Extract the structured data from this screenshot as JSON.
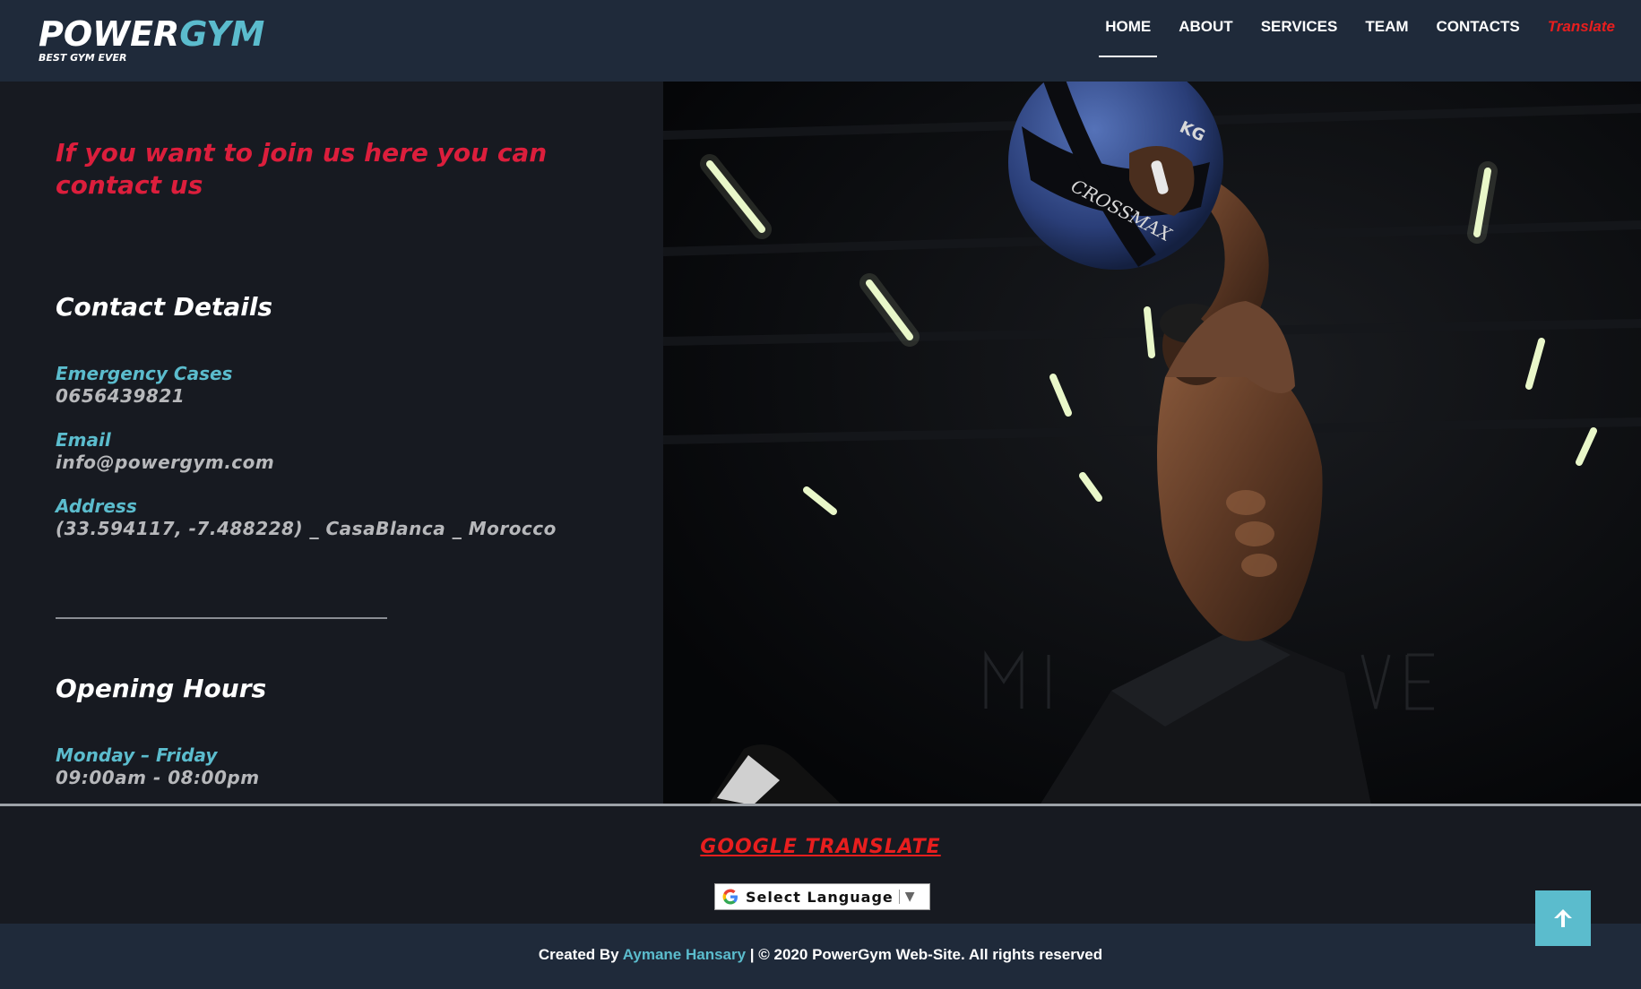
{
  "header": {
    "logo_main": "POWER",
    "logo_accent": "GYM",
    "logo_tagline": "BEST GYM EVER",
    "nav": {
      "home": "HOME",
      "about": "ABOUT",
      "services": "SERVICES",
      "team": "TEAM",
      "contacts": "CONTACTS",
      "translate": "Translate"
    },
    "active_nav": "HOME"
  },
  "contact": {
    "intro": "If you want to join us here you can contact us",
    "details_title": "Contact Details",
    "emergency_label": "Emergency Cases",
    "emergency_value": "0656439821",
    "email_label": "Email",
    "email_value": "info@powergym.com",
    "address_label": "Address",
    "address_value": "(33.594117, -7.488228) _ CasaBlanca _ Morocco",
    "hours_title": "Opening Hours",
    "hours_label": "Monday – Friday",
    "hours_value": "09:00am - 08:00pm"
  },
  "hero": {
    "ball_text": "CROSSMAX",
    "ball_weight": "KG"
  },
  "translate_section": {
    "title": "GOOGLE TRANSLATE",
    "select_label": "Select Language",
    "select_arrow": "▼"
  },
  "footer": {
    "created_by": "Created By",
    "author": "Aymane Hansary",
    "rights": "| © 2020 PowerGym Web-Site. All rights reserved"
  },
  "icons": {
    "scroll_top": "arrow-up-icon",
    "google": "google-g-icon"
  },
  "colors": {
    "header_bg": "#1f2a3a",
    "page_bg": "#171a21",
    "accent_teal": "#5bbccd",
    "accent_red": "#e81e1e",
    "intro_red": "#dc1e3c"
  }
}
